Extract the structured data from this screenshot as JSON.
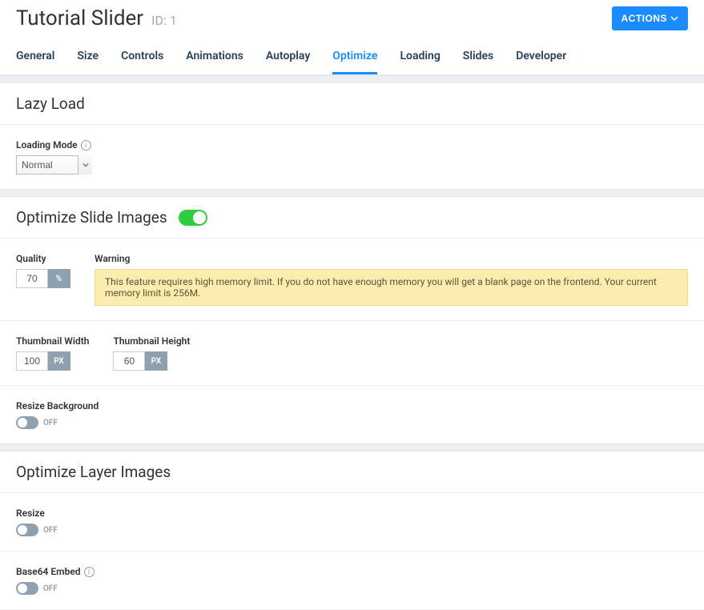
{
  "header": {
    "title": "Tutorial Slider",
    "id_label": "ID: 1",
    "actions_label": "ACTIONS"
  },
  "tabs": [
    {
      "label": "General"
    },
    {
      "label": "Size"
    },
    {
      "label": "Controls"
    },
    {
      "label": "Animations"
    },
    {
      "label": "Autoplay"
    },
    {
      "label": "Optimize",
      "active": true
    },
    {
      "label": "Loading"
    },
    {
      "label": "Slides"
    },
    {
      "label": "Developer"
    }
  ],
  "sections": {
    "lazy_load": {
      "title": "Lazy Load",
      "loading_mode_label": "Loading Mode",
      "loading_mode_value": "Normal"
    },
    "optimize_slide": {
      "title": "Optimize Slide Images",
      "toggle_on": true,
      "quality_label": "Quality",
      "quality_value": "70",
      "quality_unit": "%",
      "warning_label": "Warning",
      "warning_text": "This feature requires high memory limit. If you do not have enough memory you will get a blank page on the frontend. Your current memory limit is 256M.",
      "thumb_width_label": "Thumbnail Width",
      "thumb_width_value": "100",
      "thumb_height_label": "Thumbnail Height",
      "thumb_height_value": "60",
      "px_unit": "PX",
      "resize_bg_label": "Resize Background",
      "off_label": "OFF"
    },
    "optimize_layer": {
      "title": "Optimize Layer Images",
      "resize_label": "Resize",
      "base64_label": "Base64 Embed",
      "off_label": "OFF"
    }
  }
}
